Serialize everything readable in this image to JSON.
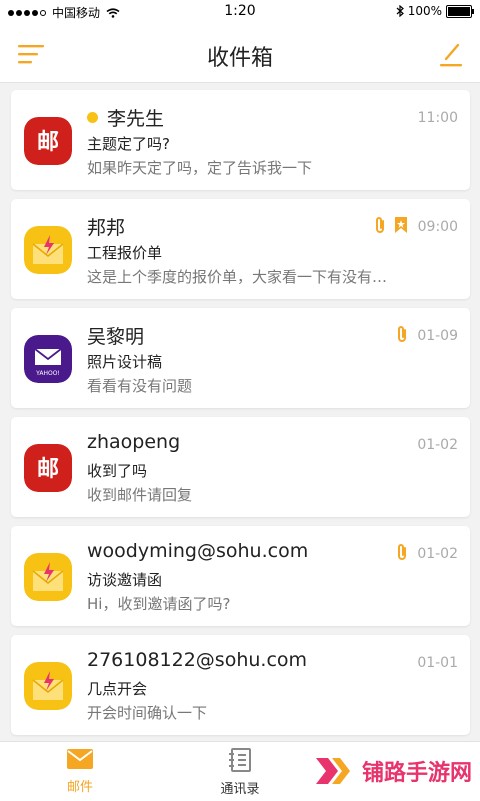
{
  "status_bar": {
    "carrier": "中国移动",
    "time": "1:20",
    "battery": "100%"
  },
  "header": {
    "title": "收件箱"
  },
  "emails": [
    {
      "sender": "李先生",
      "subject": "主题定了吗?",
      "preview": "如果昨天定了吗，定了告诉我一下",
      "time": "11:00",
      "avatar": "mail-163-red",
      "unread": true,
      "attachment": false,
      "flagged": false
    },
    {
      "sender": "邦邦",
      "subject": "工程报价单",
      "preview": "这是上个季度的报价单，大家看一下有没有…",
      "time": "09:00",
      "avatar": "mail-yellow-envelope",
      "unread": false,
      "attachment": true,
      "flagged": true
    },
    {
      "sender": "吴黎明",
      "subject": "照片设计稿",
      "preview": "看看有没有问题",
      "time": "01-09",
      "avatar": "mail-yahoo-purple",
      "unread": false,
      "attachment": true,
      "flagged": false
    },
    {
      "sender": "zhaopeng",
      "subject": "收到了吗",
      "preview": "收到邮件请回复",
      "time": "01-02",
      "avatar": "mail-163-red",
      "unread": false,
      "attachment": false,
      "flagged": false
    },
    {
      "sender": "woodyming@sohu.com",
      "subject": "访谈邀请函",
      "preview": "Hi，收到邀请函了吗?",
      "time": "01-02",
      "avatar": "mail-yellow-envelope",
      "unread": false,
      "attachment": true,
      "flagged": false
    },
    {
      "sender": "276108122@sohu.com",
      "subject": "几点开会",
      "preview": "开会时间确认一下",
      "time": "01-01",
      "avatar": "mail-yellow-envelope",
      "unread": false,
      "attachment": false,
      "flagged": false
    }
  ],
  "avatar_text": {
    "red": "邮",
    "yahoo": "YAHOO!"
  },
  "tabs": [
    {
      "label": "邮件",
      "icon": "mail-icon",
      "active": true
    },
    {
      "label": "通讯录",
      "icon": "contacts-icon",
      "active": false
    }
  ],
  "watermark": "铺路手游网",
  "colors": {
    "accent": "#f7c214",
    "tab_active": "#f5a623",
    "red": "#d0201c",
    "yahoo": "#4a1a8c"
  }
}
